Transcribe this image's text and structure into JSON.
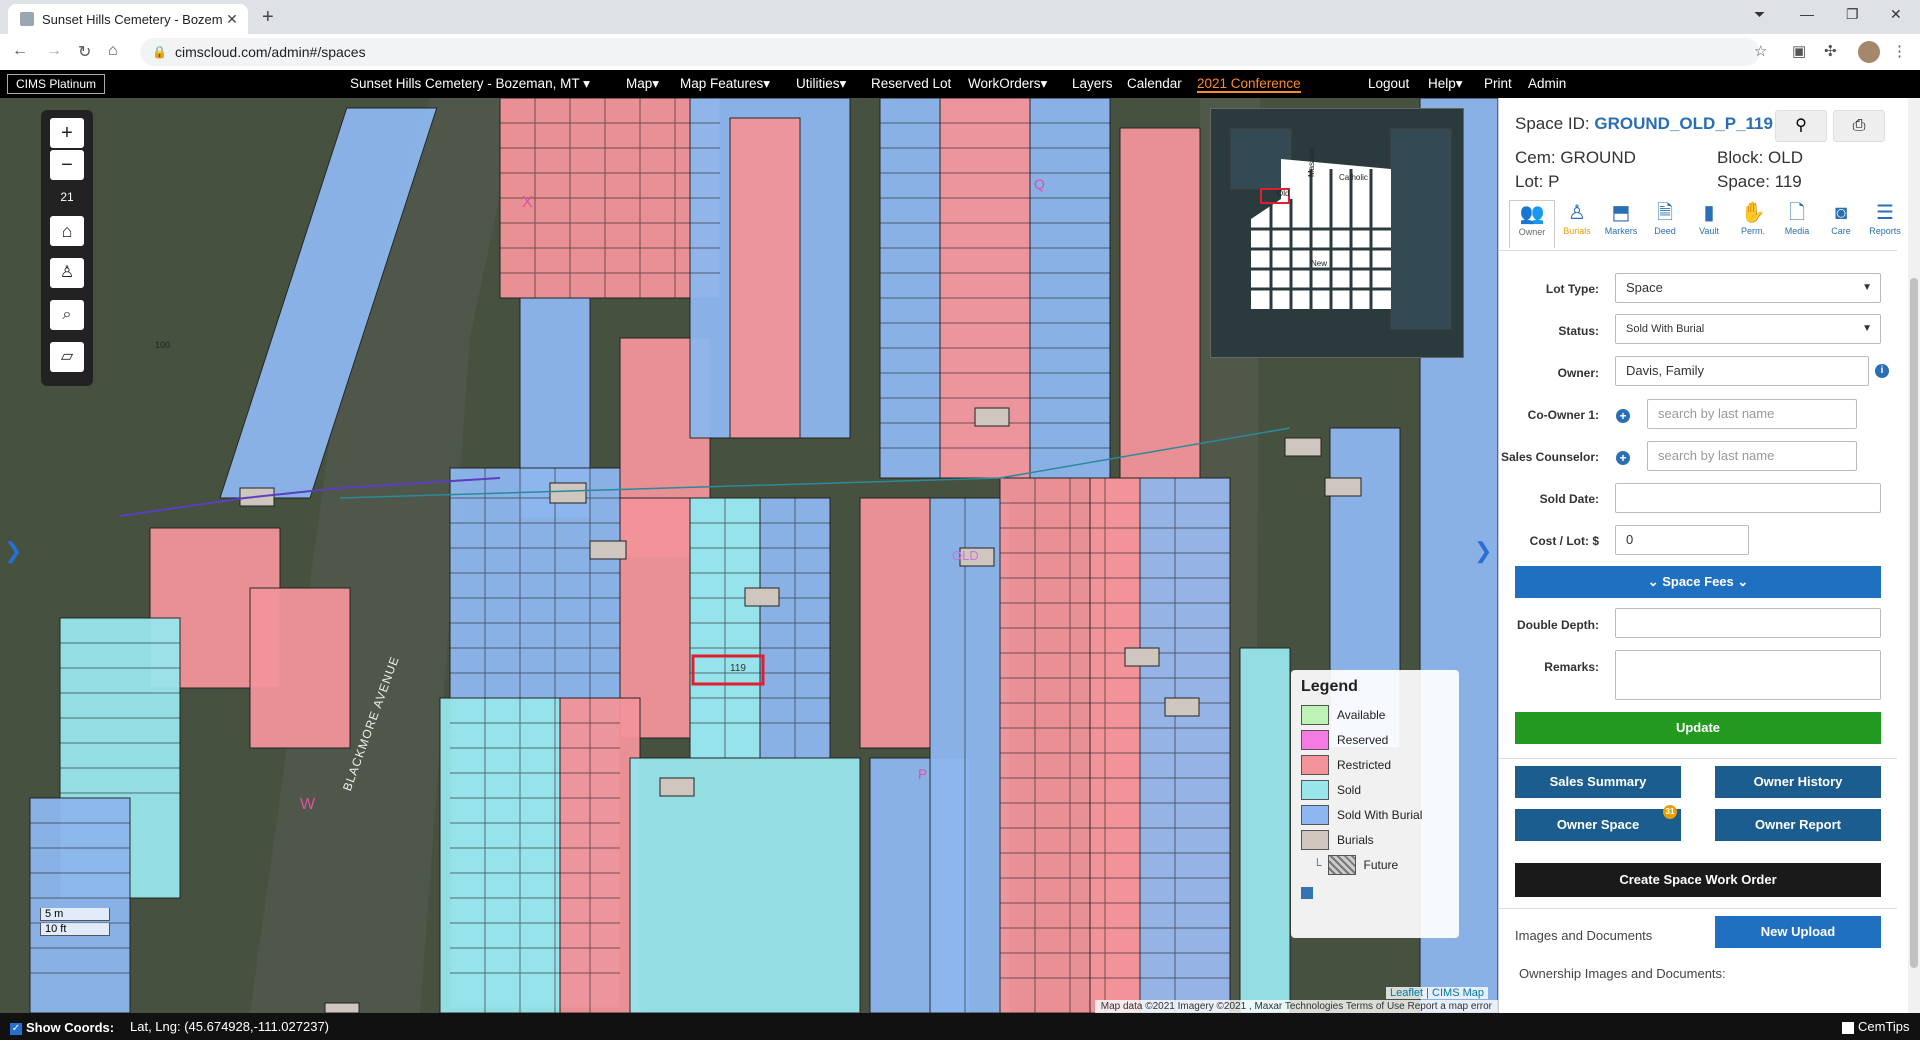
{
  "browser": {
    "tab_title": "Sunset Hills Cemetery - Bozeman",
    "url": "cimscloud.com/admin#/spaces"
  },
  "navbar": {
    "brand": "CIMS Platinum",
    "cemetery": "Sunset Hills Cemetery - Bozeman, MT ▾",
    "items": [
      "Map▾",
      "Map Features▾",
      "Utilities▾",
      "Reserved Lot",
      "WorkOrders▾",
      "Layers",
      "Calendar",
      "2021 Conference"
    ],
    "right_items": [
      "Logout",
      "Help▾",
      "Print",
      "Admin"
    ]
  },
  "map": {
    "zoom": "21",
    "street_label": "BLACKMORE AVENUE",
    "section_labels": [
      "OLD",
      "X",
      "W",
      "P",
      "Q"
    ],
    "scale": [
      "5 m",
      "10 ft"
    ],
    "attribution": "Map data ©2021 Imagery ©2021 , Maxar Technologies   Terms of Use   Report a map error",
    "leaflet": "Leaflet | CIMS Map",
    "minimap_labels": [
      "Old",
      "Masonic",
      "Catholic",
      "New"
    ],
    "legend": {
      "title": "Legend",
      "items": [
        {
          "label": "Available",
          "color": "#bdf3b5"
        },
        {
          "label": "Reserved",
          "color": "#f77be3"
        },
        {
          "label": "Restricted",
          "color": "#f2949a"
        },
        {
          "label": "Sold",
          "color": "#98e6ec"
        },
        {
          "label": "Sold With Burial",
          "color": "#8db7ee"
        },
        {
          "label": "Burials",
          "color": "#cfc7bf"
        }
      ],
      "sub_item": "Future"
    },
    "colors": {
      "restricted": "#f2949a",
      "sold": "#98e6ec",
      "burial": "#8db7ee",
      "marker": "#cfc7bf",
      "selected": "#e01e2e"
    }
  },
  "panel": {
    "space_id_label": "Space ID:",
    "space_id": "GROUND_OLD_P_119",
    "cem": "Cem: GROUND",
    "block": "Block: OLD",
    "lot": "Lot: P",
    "space": "Space: 119",
    "tabs": [
      "Owner",
      "Burials",
      "Markers",
      "Deed",
      "Vault",
      "Perm.",
      "Media",
      "Care",
      "Reports"
    ],
    "fields": {
      "lot_type_label": "Lot Type:",
      "lot_type": "Space",
      "status_label": "Status:",
      "status": "Sold With Burial",
      "owner_label": "Owner:",
      "owner": "Davis, Family",
      "coowner_label": "Co-Owner 1:",
      "coowner_placeholder": "search by last name",
      "sales_label": "Sales Counselor:",
      "sales_placeholder": "search by last name",
      "sold_date_label": "Sold Date:",
      "cost_label": "Cost / Lot: $",
      "cost": "0",
      "double_depth_label": "Double Depth:",
      "remarks_label": "Remarks:"
    },
    "space_fees": "Space Fees",
    "update": "Update",
    "sales_summary": "Sales Summary",
    "owner_history": "Owner History",
    "owner_space": "Owner Space",
    "owner_space_badge": "31",
    "owner_report": "Owner Report",
    "create_wo": "Create Space Work Order",
    "images_docs": "Images and Documents",
    "new_upload": "New Upload",
    "ownership_docs": "Ownership Images and Documents:"
  },
  "bottombar": {
    "show_coords": "Show Coords:",
    "latlng": "Lat, Lng: (45.674928,-111.027237)",
    "cemtips": "CemTips"
  }
}
